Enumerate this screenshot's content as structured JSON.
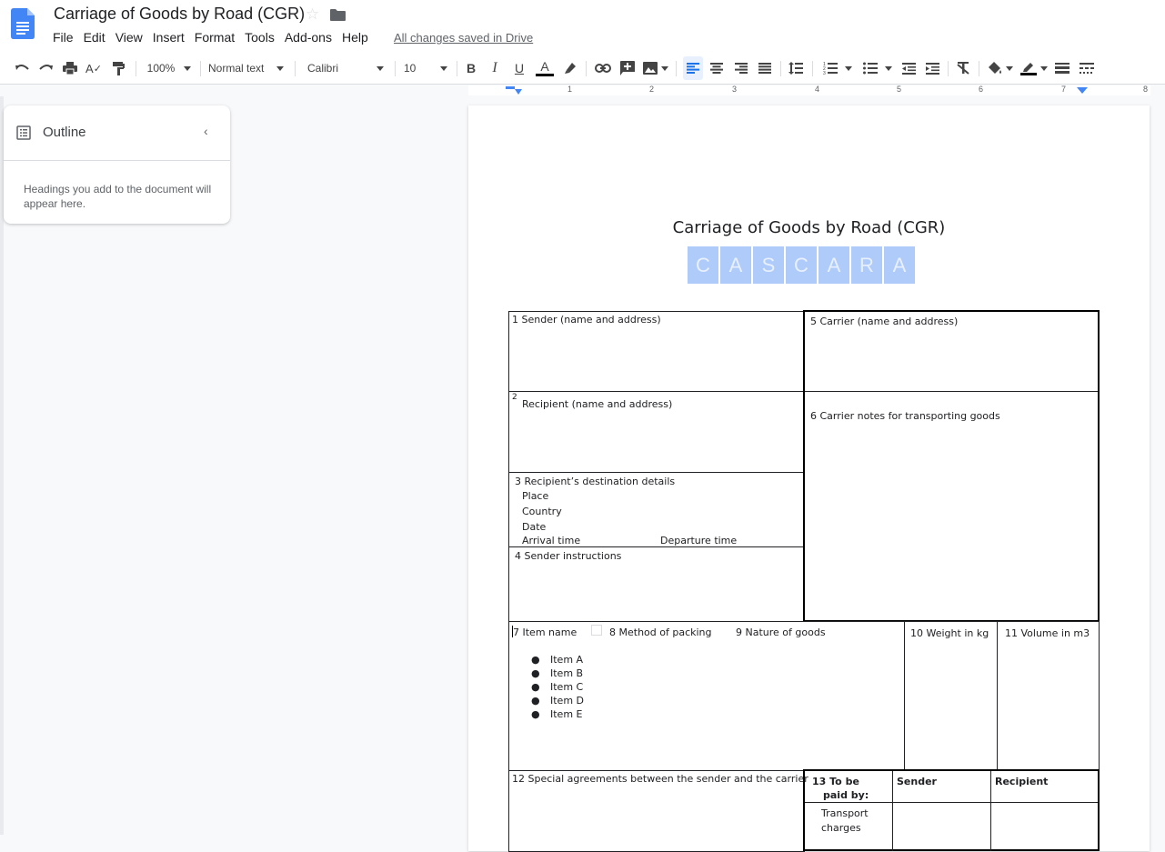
{
  "app": {
    "doc_title": "Carriage of Goods by Road (CGR)",
    "menu": [
      "File",
      "Edit",
      "View",
      "Insert",
      "Format",
      "Tools",
      "Add-ons",
      "Help"
    ],
    "save_status": "All changes saved in Drive"
  },
  "toolbar": {
    "zoom": "100%",
    "style": "Normal text",
    "font": "Calibri",
    "font_size": "10"
  },
  "ruler": {
    "marks": [
      "1",
      "2",
      "3",
      "4",
      "5",
      "6",
      "7",
      "8"
    ]
  },
  "outline": {
    "title": "Outline",
    "hint": "Headings you add to the document will appear here."
  },
  "document": {
    "heading": "Carriage of Goods by Road (CGR)",
    "logo_letters": [
      "C",
      "A",
      "S",
      "C",
      "A",
      "R",
      "A"
    ],
    "form": {
      "sender": "1 Sender (name and address)",
      "recipient_num": "2",
      "recipient": "Recipient (name and address)",
      "destination_title": "3 Recipient’s destination details",
      "place": "Place",
      "country": "Country",
      "date": "Date",
      "arrival": "Arrival time",
      "departure": "Departure time",
      "sender_instructions": "4 Sender instructions",
      "carrier": "5 Carrier (name and address)",
      "carrier_notes": "6 Carrier notes for transporting goods",
      "item_name": "7 Item name",
      "method_packing": "8 Method of packing",
      "nature_goods": "9 Nature of goods",
      "weight": "10 Weight in kg",
      "volume": "11 Volume in m3",
      "items": [
        "Item A",
        "Item B",
        "Item C",
        "Item D",
        "Item E"
      ],
      "special": "12 Special agreements between the sender and the carrier",
      "paid_by_1": "13 To be",
      "paid_by_2": "paid by:",
      "col_sender": "Sender",
      "col_recipient": "Recipient",
      "transport_1": "Transport",
      "transport_2": "charges"
    }
  }
}
